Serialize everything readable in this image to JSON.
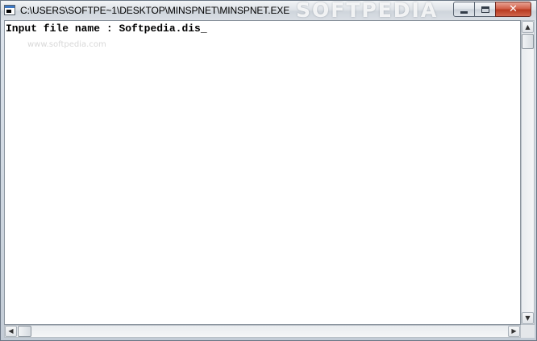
{
  "window": {
    "title": "C:\\USERS\\SOFTPE~1\\DESKTOP\\MINSPNET\\MINSPNET.EXE",
    "watermark": "SOFTPEDIA",
    "controls": {
      "minimize": "minimize-icon",
      "maximize": "maximize-icon",
      "close": "close-icon"
    },
    "close_glyph": "✕"
  },
  "console": {
    "prompt_label": "Input file name : ",
    "input_value": "Softpedia.dis",
    "cursor": "_",
    "watermark": "www.softpedia.com"
  },
  "scrollbars": {
    "up_arrow": "▲",
    "down_arrow": "▼",
    "left_arrow": "◀",
    "right_arrow": "▶"
  }
}
